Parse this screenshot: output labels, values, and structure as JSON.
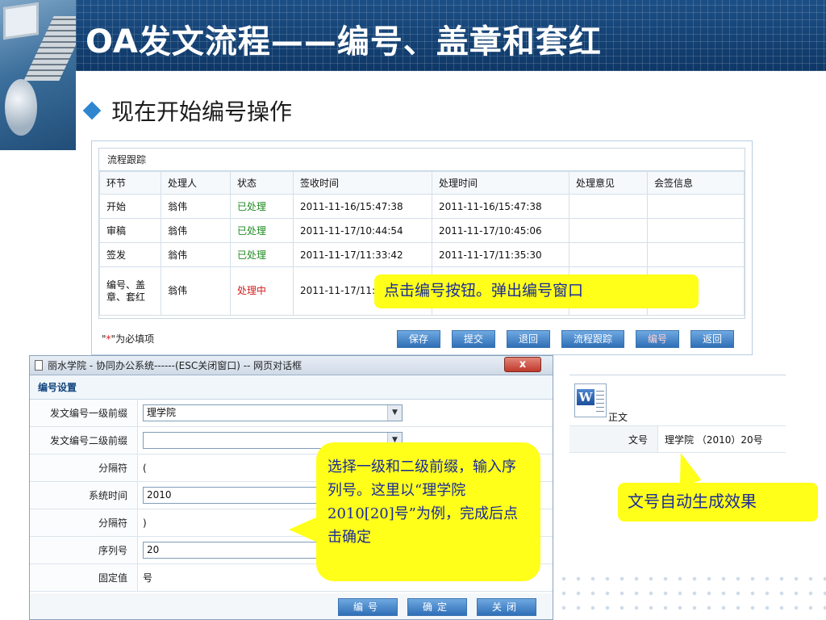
{
  "slide": {
    "title": "OA发文流程——编号、盖章和套红",
    "bullet": "现在开始编号操作"
  },
  "flow": {
    "caption": "流程跟踪",
    "headers": [
      "环节",
      "处理人",
      "状态",
      "签收时间",
      "处理时间",
      "处理意见",
      "会签信息"
    ],
    "rows": [
      {
        "step": "开始",
        "handler": "翁伟",
        "status": "已处理",
        "received": "2011-11-16/15:47:38",
        "processed": "2011-11-16/15:47:38",
        "opinion": "",
        "countersign": ""
      },
      {
        "step": "审稿",
        "handler": "翁伟",
        "status": "已处理",
        "received": "2011-11-17/10:44:54",
        "processed": "2011-11-17/10:45:06",
        "opinion": "",
        "countersign": ""
      },
      {
        "step": "签发",
        "handler": "翁伟",
        "status": "已处理",
        "received": "2011-11-17/11:33:42",
        "processed": "2011-11-17/11:35:30",
        "opinion": "",
        "countersign": ""
      },
      {
        "step": "编号、盖章、套红",
        "handler": "翁伟",
        "status": "处理中",
        "received": "2011-11-17/11:",
        "processed": "",
        "opinion": "",
        "countersign": ""
      }
    ],
    "required_star": "*",
    "required_text": "为必填项",
    "buttons": {
      "save": "保存",
      "submit": "提交",
      "back": "退回",
      "track": "流程跟踪",
      "number": "编号",
      "return": "返回"
    }
  },
  "callouts": {
    "number_button": "点击编号按钮。弹出编号窗口",
    "select_prefix": "选择一级和二级前缀，输入序列号。这里以“理学院2010[20]号”为例，完成后点击确定",
    "auto_result": "文号自动生成效果"
  },
  "dialog": {
    "window_title": "丽水学院 - 协同办公系统------(ESC关闭窗口) -- 网页对话框",
    "close_label": "x",
    "section": "编号设置",
    "fields": {
      "prefix1_label": "发文编号一级前缀",
      "prefix1_value": "理学院",
      "prefix2_label": "发文编号二级前缀",
      "prefix2_value": "",
      "sep1_label": "分隔符",
      "sep1_value": "(",
      "systime_label": "系统时间",
      "systime_value": "2010",
      "sep2_label": "分隔符",
      "sep2_value": ")",
      "serial_label": "序列号",
      "serial_value": "20",
      "fixed_label": "固定值",
      "fixed_value": "号"
    },
    "buttons": {
      "number": "编号",
      "confirm": "确定",
      "close": "关闭"
    }
  },
  "result": {
    "doc_label": "正文",
    "docno_label": "文号",
    "docno_value": "理学院 （2010）20号"
  }
}
